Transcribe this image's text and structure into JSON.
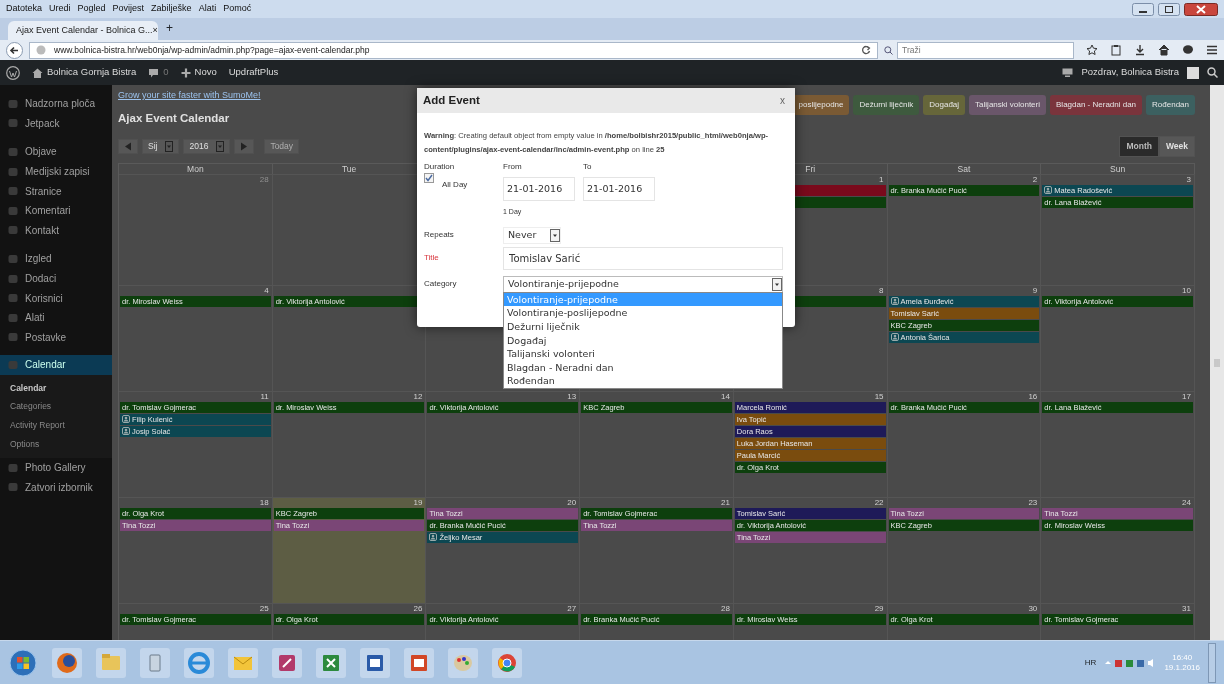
{
  "browser": {
    "menu": [
      "Datoteka",
      "Uredi",
      "Pogled",
      "Povijest",
      "Zabilješke",
      "Alati",
      "Pomoć"
    ],
    "tab": {
      "title": "Ajax Event Calendar - Bolnica G...",
      "close": "×"
    },
    "new_tab": "+",
    "url": "www.bolnica-bistra.hr/web0nja/wp-admin/admin.php?page=ajax-event-calendar.php",
    "search_placeholder": "Traži"
  },
  "admin_bar": {
    "site": "Bolnica Gornja Bistra",
    "comments": "0",
    "new": "Novo",
    "plugin": "UpdraftPlus",
    "greeting": "Pozdrav, Bolnica Bistra"
  },
  "sidebar": {
    "items": [
      {
        "label": "Nadzorna ploča",
        "selected": false
      },
      {
        "label": "Jetpack",
        "selected": false
      },
      {
        "label": "Objave",
        "selected": false
      },
      {
        "label": "Medijski zapisi",
        "selected": false
      },
      {
        "label": "Stranice",
        "selected": false
      },
      {
        "label": "Komentari",
        "selected": false
      },
      {
        "label": "Kontakt",
        "selected": false
      },
      {
        "label": "Izgled",
        "selected": false
      },
      {
        "label": "Dodaci",
        "selected": false
      },
      {
        "label": "Korisnici",
        "selected": false
      },
      {
        "label": "Alati",
        "selected": false
      },
      {
        "label": "Postavke",
        "selected": false
      },
      {
        "label": "Calendar",
        "selected": true
      }
    ],
    "submenu": [
      {
        "label": "Calendar",
        "selected": true
      },
      {
        "label": "Categories",
        "selected": false
      },
      {
        "label": "Activity Report",
        "selected": false
      },
      {
        "label": "Options",
        "selected": false
      }
    ],
    "items_after": [
      "Photo Gallery",
      "Zatvori izbornik"
    ]
  },
  "calendar": {
    "promo_link": "Grow your site faster with SumoMe!",
    "title": "Ajax Event Calendar",
    "month": "Sij",
    "year": "2016",
    "today_button": "Today",
    "legend": [
      {
        "label": "poslijepodne",
        "color": "#7a5a34"
      },
      {
        "label": "Dežurni liječnik",
        "color": "#3e5a3e"
      },
      {
        "label": "Događaj",
        "color": "#66663a"
      },
      {
        "label": "Talijanski volonteri",
        "color": "#6a566a"
      },
      {
        "label": "Blagdan - Neradni dan",
        "color": "#7a343c"
      },
      {
        "label": "Rođendan",
        "color": "#3c6060"
      }
    ],
    "views": [
      {
        "label": "Month",
        "selected": true
      },
      {
        "label": "Week",
        "selected": false
      }
    ],
    "weekdays": {
      "mon": "Mon",
      "tue": "Tue",
      "fri": "Fri",
      "sat": "Sat",
      "sun": "Sun"
    },
    "weeks": [
      {
        "days": {
          "mon": {
            "date": "28",
            "muted": true,
            "today": false
          },
          "tue": {
            "today": false
          },
          "fri": {
            "date": "1",
            "muted": false,
            "today": false,
            "events": [
              {
                "color": "#7a0a1c"
              },
              {
                "color": "#0d3f0d"
              }
            ]
          },
          "sat": {
            "date": "2",
            "muted": false,
            "today": false,
            "events": [
              {
                "title": "dr. Branka Mučić Pucić",
                "color": "#0d3f0d",
                "icon": false
              }
            ]
          },
          "sun": {
            "date": "3",
            "muted": false,
            "today": false,
            "events": [
              {
                "title": "Matea Radošević",
                "color": "#0c4752",
                "icon": true
              },
              {
                "title": "dr. Lana Blažević",
                "color": "#0d3f0d",
                "icon": false
              }
            ]
          }
        }
      },
      {
        "days": {
          "mon": {
            "date": "4",
            "muted": false,
            "today": false,
            "events": [
              {
                "title": "dr. Miroslav Weiss",
                "color": "#0d3f0d",
                "icon": false
              }
            ]
          },
          "tue": {
            "today": false,
            "events": [
              {
                "title": "dr. Viktorija Antolović",
                "color": "#0d3f0d",
                "icon": false
              }
            ]
          },
          "fri": {
            "date": "8",
            "muted": false,
            "today": false,
            "events": [
              {
                "color": "#0d3f0d"
              }
            ]
          },
          "sat": {
            "date": "9",
            "muted": false,
            "today": false,
            "events": [
              {
                "title": "Amela Đurđević",
                "color": "#0c4752",
                "icon": true
              },
              {
                "title": "Tomislav Sarić",
                "color": "#7a4c0e",
                "icon": false
              },
              {
                "title": "KBC Zagreb",
                "color": "#0d3f0d",
                "icon": false
              },
              {
                "title": "Antonia Šarica",
                "color": "#0c4752",
                "icon": true
              }
            ]
          },
          "sun": {
            "date": "10",
            "muted": false,
            "today": false,
            "events": [
              {
                "title": "dr. Viktorija Antolović",
                "color": "#0d3f0d",
                "icon": false
              }
            ]
          }
        }
      },
      {
        "days": {
          "mon": {
            "date": "11",
            "muted": false,
            "today": false,
            "events": [
              {
                "title": "dr. Tomislav Gojmerac",
                "color": "#0d3f0d",
                "icon": false
              },
              {
                "title": "Filip Kulenić",
                "color": "#0c4752",
                "icon": true
              },
              {
                "title": "Josip Solać",
                "color": "#0c4752",
                "icon": true
              }
            ]
          },
          "tue": {
            "date": "12",
            "muted": false,
            "today": false,
            "events": [
              {
                "title": "dr. Miroslav Weiss",
                "color": "#0d3f0d",
                "icon": false
              }
            ]
          },
          "wed": {
            "date": "13",
            "muted": false,
            "today": false,
            "events": [
              {
                "title": "dr. Viktorija Antolović",
                "color": "#0d3f0d",
                "icon": false
              }
            ]
          },
          "thu": {
            "date": "14",
            "muted": false,
            "today": false,
            "events": [
              {
                "title": "KBC Zagreb",
                "color": "#0d3f0d",
                "icon": false
              }
            ]
          },
          "fri": {
            "date": "15",
            "muted": false,
            "today": false,
            "events": [
              {
                "title": "Marcela Romić",
                "color": "#1e1a58",
                "icon": false
              },
              {
                "title": "Iva Topić",
                "color": "#7a4c0e",
                "icon": false
              },
              {
                "title": "Dora Raos",
                "color": "#1e1a58",
                "icon": false
              },
              {
                "title": "Luka Jordan Haseman",
                "color": "#7a4c0e",
                "icon": false
              },
              {
                "title": "Paula Marcić",
                "color": "#7a4c0e",
                "icon": false
              },
              {
                "title": "dr. Olga Krot",
                "color": "#0d3f0d",
                "icon": false
              }
            ]
          },
          "sat": {
            "date": "16",
            "muted": false,
            "today": false,
            "events": [
              {
                "title": "dr. Branka Mučić Pucić",
                "color": "#0d3f0d",
                "icon": false
              }
            ]
          },
          "sun": {
            "date": "17",
            "muted": false,
            "today": false,
            "events": [
              {
                "title": "dr. Lana Blažević",
                "color": "#0d3f0d",
                "icon": false
              }
            ]
          }
        }
      },
      {
        "days": {
          "mon": {
            "date": "18",
            "muted": false,
            "today": false,
            "events": [
              {
                "title": "dr. Olga Krot",
                "color": "#0d3f0d",
                "icon": false
              },
              {
                "title": "Tina Tozzi",
                "color": "#7a4676",
                "icon": false
              }
            ]
          },
          "tue": {
            "date": "19",
            "muted": false,
            "today": true,
            "events": [
              {
                "title": "KBC Zagreb",
                "color": "#0d3f0d",
                "icon": false
              },
              {
                "title": "Tina Tozzi",
                "color": "#7a4676",
                "icon": false
              }
            ]
          },
          "wed": {
            "date": "20",
            "muted": false,
            "today": false,
            "events": [
              {
                "title": "Tina Tozzi",
                "color": "#7a4676",
                "icon": false
              },
              {
                "title": "dr. Branka Mučić Pucić",
                "color": "#0d3f0d",
                "icon": false
              },
              {
                "title": "Željko Mesar",
                "color": "#0c4752",
                "icon": true
              }
            ]
          },
          "thu": {
            "date": "21",
            "muted": false,
            "today": false,
            "events": [
              {
                "title": "dr. Tomislav Gojmerac",
                "color": "#0d3f0d",
                "icon": false
              },
              {
                "title": "Tina Tozzi",
                "color": "#7a4676",
                "icon": false
              }
            ]
          },
          "fri": {
            "date": "22",
            "muted": false,
            "today": false,
            "events": [
              {
                "title": "Tomislav Sarić",
                "color": "#1e1a58",
                "icon": false
              },
              {
                "title": "dr. Viktorija Antolović",
                "color": "#0d3f0d",
                "icon": false
              },
              {
                "title": "Tina Tozzi",
                "color": "#7a4676",
                "icon": false
              }
            ]
          },
          "sat": {
            "date": "23",
            "muted": false,
            "today": false,
            "events": [
              {
                "title": "Tina Tozzi",
                "color": "#7a4676",
                "icon": false
              },
              {
                "title": "KBC Zagreb",
                "color": "#0d3f0d",
                "icon": false
              }
            ]
          },
          "sun": {
            "date": "24",
            "muted": false,
            "today": false,
            "events": [
              {
                "title": "Tina Tozzi",
                "color": "#7a4676",
                "icon": false
              },
              {
                "title": "dr. Miroslav Weiss",
                "color": "#0d3f0d",
                "icon": false
              }
            ]
          }
        }
      },
      {
        "days": {
          "mon": {
            "date": "25",
            "muted": false,
            "today": false,
            "events": [
              {
                "title": "dr. Tomislav Gojmerac",
                "color": "#0d3f0d",
                "icon": false
              }
            ]
          },
          "tue": {
            "date": "26",
            "muted": false,
            "today": false,
            "events": [
              {
                "title": "dr. Olga Krot",
                "color": "#0d3f0d",
                "icon": false
              }
            ]
          },
          "wed": {
            "date": "27",
            "muted": false,
            "today": false,
            "events": [
              {
                "title": "dr. Viktorija Antolović",
                "color": "#0d3f0d",
                "icon": false
              }
            ]
          },
          "thu": {
            "date": "28",
            "muted": false,
            "today": false,
            "events": [
              {
                "title": "dr. Branka Mučić Pucić",
                "color": "#0d3f0d",
                "icon": false
              }
            ]
          },
          "fri": {
            "date": "29",
            "muted": false,
            "today": false,
            "events": [
              {
                "title": "dr. Miroslav Weiss",
                "color": "#0d3f0d",
                "icon": false
              }
            ]
          },
          "sat": {
            "date": "30",
            "muted": false,
            "today": false,
            "events": [
              {
                "title": "dr. Olga Krot",
                "color": "#0d3f0d",
                "icon": false
              }
            ]
          },
          "sun": {
            "date": "31",
            "muted": false,
            "today": false,
            "events": [
              {
                "title": "dr. Tomislav Gojmerac",
                "color": "#0d3f0d",
                "icon": false
              }
            ]
          }
        }
      }
    ]
  },
  "modal": {
    "title": "Add Event",
    "close": "x",
    "warning": "**Warning**: Creating default object from empty value in **/home/bolbishr2015/public_html/web0nja/wp-content/plugins/ajax-event-calendar/inc/admin-event.php** on line **25**",
    "duration_label": "Duration",
    "all_day": {
      "label": "All Day",
      "checked": true
    },
    "from_label": "From",
    "to_label": "To",
    "from": "21-01-2016",
    "to": "21-01-2016",
    "length": "1 Day",
    "repeats_label": "Repeats",
    "repeats": "Never",
    "title_label": "Title",
    "title_value": "Tomislav Sarić",
    "category_label": "Category",
    "category": "Volontiranje-prijepodne",
    "category_open": true,
    "category_options": [
      {
        "label": "Volontiranje-prijepodne",
        "selected": true
      },
      {
        "label": "Volontiranje-poslijepodne",
        "selected": false
      },
      {
        "label": "Dežurni liječnik",
        "selected": false
      },
      {
        "label": "Događaj",
        "selected": false
      },
      {
        "label": "Talijanski volonteri",
        "selected": false
      },
      {
        "label": "Blagdan - Neradni dan",
        "selected": false
      },
      {
        "label": "Rođendan",
        "selected": false
      }
    ]
  },
  "taskbar": {
    "language": "HR",
    "time": "16:40",
    "date": "19.1.2016"
  }
}
